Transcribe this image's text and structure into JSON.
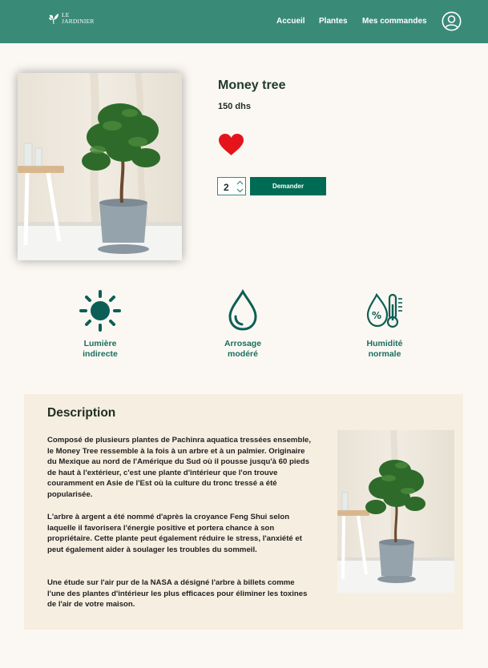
{
  "header": {
    "logo": {
      "line1": "LE",
      "line2": "JARDINIER"
    },
    "nav": [
      "Accueil",
      "Plantes",
      "Mes commandes"
    ],
    "user_icon": "user-circle-icon"
  },
  "product": {
    "name": "Money tree",
    "price": "150 dhs",
    "favorite_icon": "heart-icon",
    "favorite_color": "#e5141b",
    "quantity": "2",
    "order_button": "Demander"
  },
  "features": [
    {
      "icon": "sun-icon",
      "line1": "Lumière",
      "line2": "indirecte"
    },
    {
      "icon": "water-drop-icon",
      "line1": "Arrosage",
      "line2": "modéré"
    },
    {
      "icon": "humidity-thermometer-icon",
      "line1": "Humidité",
      "line2": "normale"
    }
  ],
  "description": {
    "title": "Description",
    "paragraphs": [
      "Composé de plusieurs plantes de Pachinra aquatica tressées ensemble, le Money Tree ressemble à la fois à un arbre et à un palmier. Originaire du Mexique au nord de l'Amérique du Sud où il pousse jusqu'à 60 pieds de haut à l'extérieur, c'est une plante d'intérieur que l'on trouve couramment en Asie de l'Est où la culture du tronc tressé a été popularisée.",
      "L'arbre à argent a été nommé d'après la croyance Feng Shui selon laquelle il favorisera l'énergie positive et portera chance à son propriétaire. Cette plante peut également réduire le stress, l'anxiété et peut également aider à soulager les troubles du sommeil.",
      "Une étude sur l'air pur de la NASA a désigné l'arbre à billets comme l'une des plantes d'intérieur les plus efficaces pour éliminer les toxines de l'air de votre maison."
    ]
  },
  "colors": {
    "header": "#3a8a78",
    "primary": "#006b54",
    "accent_text": "#1a6e5e",
    "card_bg": "#f6eee0",
    "page_bg": "#fbf8f3"
  }
}
